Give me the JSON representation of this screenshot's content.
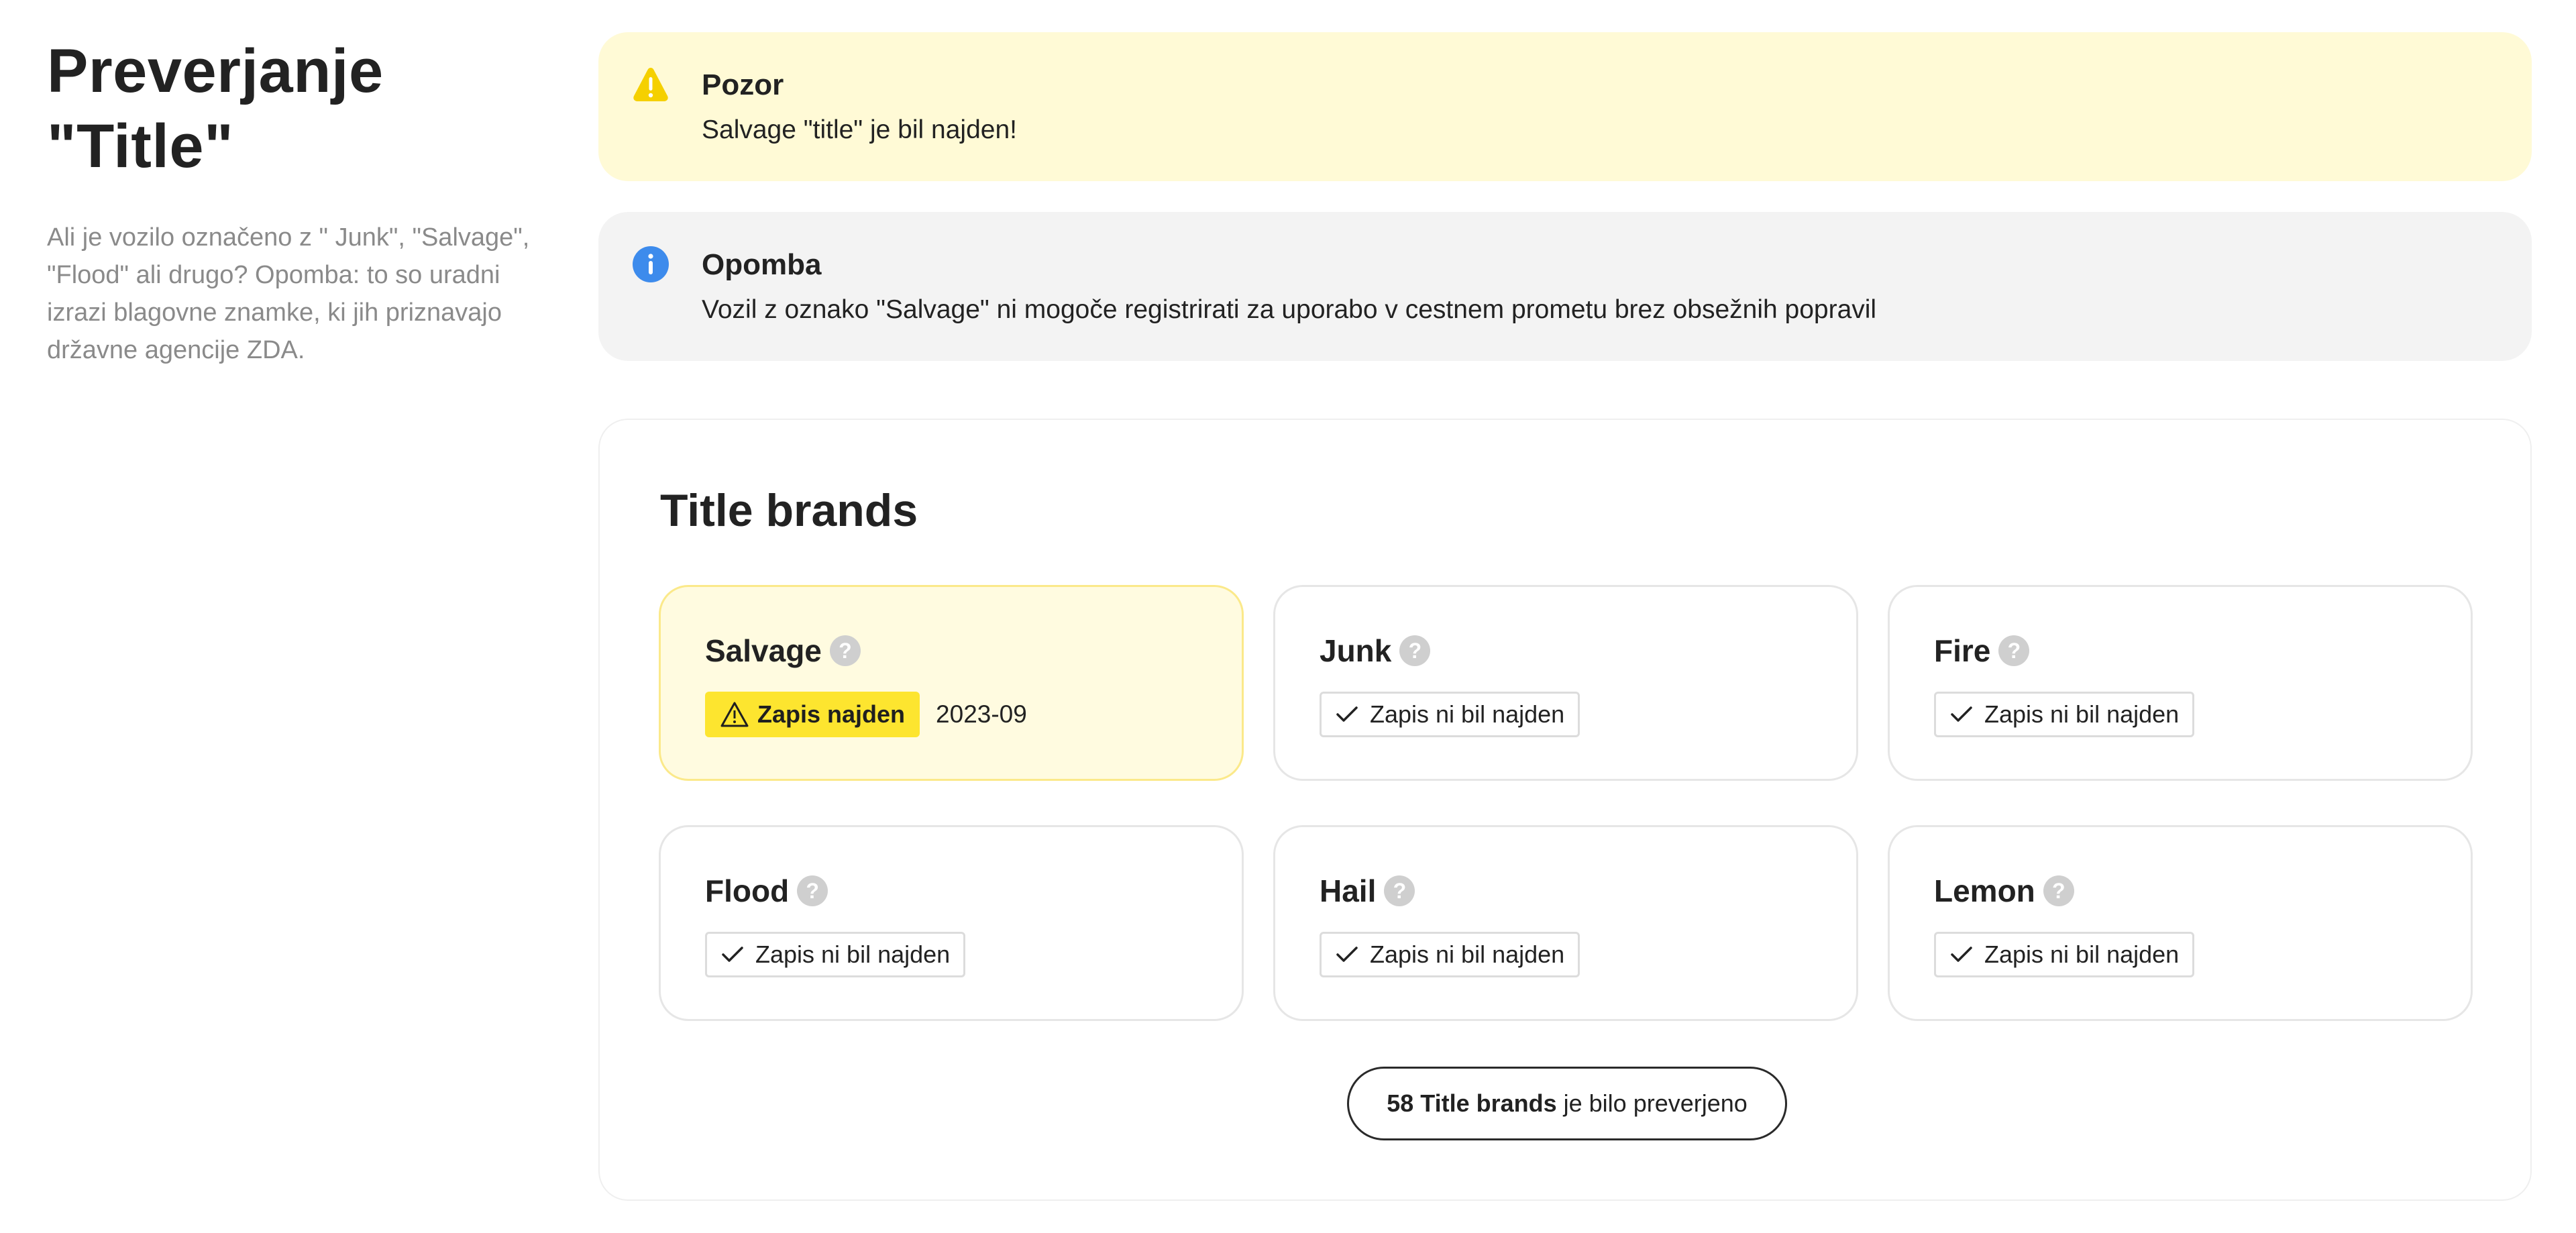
{
  "header": {
    "title_line1": "Preverjanje",
    "title_line2": "\"Title\"",
    "description": "Ali je vozilo označeno z \" Junk\", \"Salvage\", \"Flood\" ali drugo? Opomba: to so uradni izrazi blagovne znamke, ki jih priznavajo državne agencije ZDA."
  },
  "alerts": {
    "warning": {
      "title": "Pozor",
      "text": "Salvage \"title\" je bil najden!",
      "icon": "warning-triangle-icon",
      "color": "#fffad6",
      "icon_color": "#f5d000"
    },
    "info": {
      "title": "Opomba",
      "text": "Vozil z oznako \"Salvage\" ni mogoče registrirati za uporabo v cestnem prometu brez obsežnih popravil",
      "icon": "info-circle-icon",
      "color": "#f3f3f3",
      "icon_color": "#3d8bec"
    }
  },
  "brands": {
    "title": "Title brands",
    "help_glyph": "?",
    "items": [
      {
        "name": "Salvage",
        "status": "found",
        "status_label": "Zapis najden",
        "date": "2023-09"
      },
      {
        "name": "Junk",
        "status": "clear",
        "status_label": "Zapis ni bil najden"
      },
      {
        "name": "Fire",
        "status": "clear",
        "status_label": "Zapis ni bil najden"
      },
      {
        "name": "Flood",
        "status": "clear",
        "status_label": "Zapis ni bil najden"
      },
      {
        "name": "Hail",
        "status": "clear",
        "status_label": "Zapis ni bil najden"
      },
      {
        "name": "Lemon",
        "status": "clear",
        "status_label": "Zapis ni bil najden"
      }
    ],
    "summary": {
      "count_label": "58 Title brands",
      "suffix": "je bilo preverjeno"
    }
  },
  "colors": {
    "found_badge": "#fde52f",
    "found_card": "#fffbe0"
  }
}
